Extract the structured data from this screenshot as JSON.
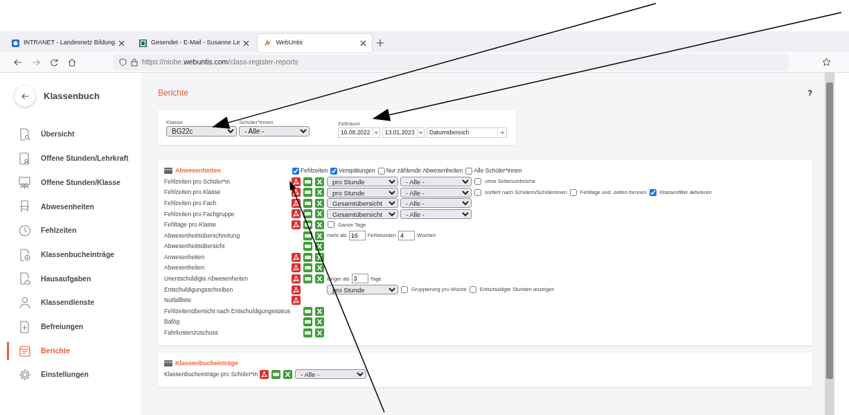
{
  "browser": {
    "tabs": [
      {
        "title": "INTRANET - Landesnetz Bildung",
        "selected": false
      },
      {
        "title": "Gesendet - E-Mail - Susanne Le",
        "selected": false
      },
      {
        "title": "WebUntis",
        "selected": true
      }
    ],
    "url": {
      "prefix": "https://niobe.",
      "domain": "webuntis.com",
      "path": "/class-register-reports"
    }
  },
  "sidebar": {
    "title": "Klassenbuch",
    "items": [
      {
        "label": "Übersicht",
        "selected": false
      },
      {
        "label": "Offene Stunden/Lehrkraft",
        "selected": false
      },
      {
        "label": "Offene Stunden/Klasse",
        "selected": false
      },
      {
        "label": "Abwesenheiten",
        "selected": false
      },
      {
        "label": "Fehlzeiten",
        "selected": false
      },
      {
        "label": "Klassenbucheinträge",
        "selected": false
      },
      {
        "label": "Hausaufgaben",
        "selected": false
      },
      {
        "label": "Klassendienste",
        "selected": false
      },
      {
        "label": "Befreiungen",
        "selected": false
      },
      {
        "label": "Berichte",
        "selected": true
      },
      {
        "label": "Einstellungen",
        "selected": false
      }
    ]
  },
  "page": {
    "title": "Berichte",
    "help": "?"
  },
  "filters": {
    "fields": [
      {
        "label": "Klasse",
        "value": "BG22c"
      },
      {
        "label": "Schüler*innen",
        "value": "- Alle -"
      }
    ],
    "period": {
      "label": "Zeitraum",
      "from": "16.08.2022",
      "to": "13.01.2023",
      "mode": "Datumsbereich"
    }
  },
  "sections": [
    {
      "title": "Abwesenheiten",
      "options": [
        {
          "label": "Fehlzeiten",
          "checked": true
        },
        {
          "label": "Verspätungen",
          "checked": true
        },
        {
          "label": "Nur zählende Abwesenheiten",
          "checked": false
        },
        {
          "label": "Alle Schüler*innen",
          "checked": false
        }
      ],
      "reports": [
        {
          "label": "Fehlzeiten pro Schüler*in",
          "pdf": true,
          "csv": true,
          "xls": true,
          "controls": [
            {
              "kind": "select",
              "value": "pro Stunde"
            },
            {
              "kind": "select",
              "value": "- Alle -"
            },
            {
              "kind": "checkbox",
              "label": "ohne Seitenumbrüche",
              "checked": false
            }
          ]
        },
        {
          "label": "Fehlzeiten pro Klasse",
          "pdf": true,
          "csv": true,
          "xls": true,
          "controls": [
            {
              "kind": "select",
              "value": "pro Stunde"
            },
            {
              "kind": "select",
              "value": "- Alle -"
            },
            {
              "kind": "checkbox",
              "label": "sortiert nach Schülern/Schülerinnen",
              "checked": false
            },
            {
              "kind": "checkbox",
              "label": "Fehltage und -zeiten trennen",
              "checked": false
            },
            {
              "kind": "checkbox",
              "label": "Klassenfilter aktivieren",
              "checked": true
            }
          ]
        },
        {
          "label": "Fehlzeiten pro Fach",
          "pdf": true,
          "csv": true,
          "xls": true,
          "controls": [
            {
              "kind": "select",
              "value": "Gesamtübersicht"
            },
            {
              "kind": "select",
              "value": "- Alle -"
            }
          ]
        },
        {
          "label": "Fehlzeiten pro Fachgruppe",
          "pdf": true,
          "csv": true,
          "xls": true,
          "controls": [
            {
              "kind": "select",
              "value": "Gesamtübersicht"
            },
            {
              "kind": "select",
              "value": "- Alle -"
            }
          ]
        },
        {
          "label": "Fehltage pro Klasse",
          "pdf": true,
          "csv": true,
          "xls": true,
          "controls": [
            {
              "kind": "checkbox",
              "label": "Ganze Tage",
              "checked": false
            }
          ]
        },
        {
          "label": "Abwesenheitsüberschreitung",
          "pdf": false,
          "csv": true,
          "xls": true,
          "controls": [
            {
              "kind": "text",
              "label": "mehr als"
            },
            {
              "kind": "input",
              "value": "16"
            },
            {
              "kind": "text",
              "label": "Fehlstunden"
            },
            {
              "kind": "input",
              "value": "4"
            },
            {
              "kind": "text",
              "label": "Wochen"
            }
          ]
        },
        {
          "label": "Abwesenheitsübersicht",
          "pdf": false,
          "csv": true,
          "xls": true
        },
        {
          "label": "Anwesenheiten",
          "pdf": true,
          "csv": true,
          "xls": true
        },
        {
          "label": "Abwesenheiten",
          "pdf": true,
          "csv": true,
          "xls": true
        },
        {
          "label": "Unentschuldigte Abwesenheiten",
          "pdf": true,
          "csv": true,
          "xls": true,
          "controls": [
            {
              "kind": "text",
              "label": "länger als"
            },
            {
              "kind": "input",
              "value": "3"
            },
            {
              "kind": "text",
              "label": "Tage"
            }
          ]
        },
        {
          "label": "Entschuldigungsschreiben",
          "pdf": true,
          "csv": false,
          "xls": false,
          "controls": [
            {
              "kind": "select",
              "value": "pro Stunde"
            },
            {
              "kind": "checkbox",
              "label": "Gruppierung pro Woche",
              "checked": false
            },
            {
              "kind": "checkbox",
              "label": "Entschuldigte Stunden anzeigen",
              "checked": false
            }
          ]
        },
        {
          "label": "Notfallliste",
          "pdf": true,
          "csv": false,
          "xls": false
        },
        {
          "label": "Fehlzeitenübersicht nach Entschuldigungsstatus",
          "pdf": false,
          "csv": true,
          "xls": true
        },
        {
          "label": "Bafög",
          "pdf": false,
          "csv": true,
          "xls": true
        },
        {
          "label": "Fahrkostenzuschuss",
          "pdf": false,
          "csv": true,
          "xls": true
        }
      ]
    },
    {
      "title": "Klassenbucheinträge",
      "reports": [
        {
          "label": "Klassenbucheinträge pro Schüler*in",
          "pdf": true,
          "csv": true,
          "xls": true,
          "controls": [
            {
              "kind": "select",
              "value": "- Alle -"
            }
          ]
        }
      ]
    }
  ]
}
